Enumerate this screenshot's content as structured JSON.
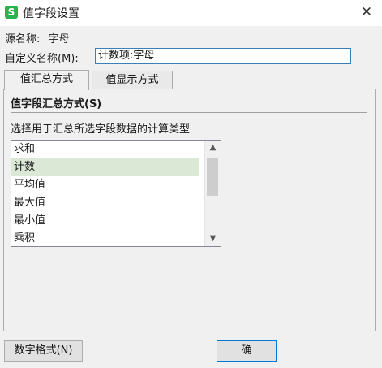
{
  "window": {
    "icon_glyph": "S",
    "title": "值字段设置",
    "close_glyph": "✕"
  },
  "source_name": {
    "label": "源名称:",
    "value": "字母"
  },
  "custom_name": {
    "label": "自定义名称(M):",
    "value": "计数项:字母"
  },
  "tabs": [
    {
      "label": "值汇总方式",
      "active": true
    },
    {
      "label": "值显示方式",
      "active": false
    }
  ],
  "summary": {
    "heading": "值字段汇总方式(S)",
    "caption": "选择用于汇总所选字段数据的计算类型",
    "items": [
      "求和",
      "计数",
      "平均值",
      "最大值",
      "最小值",
      "乘积"
    ],
    "selected_index": 1
  },
  "buttons": {
    "number_format": "数字格式(N)",
    "ok": "确"
  },
  "colors": {
    "selection": "#dce8d6",
    "app_icon": "#2bb24c",
    "focus_border": "#3c7fb1"
  }
}
